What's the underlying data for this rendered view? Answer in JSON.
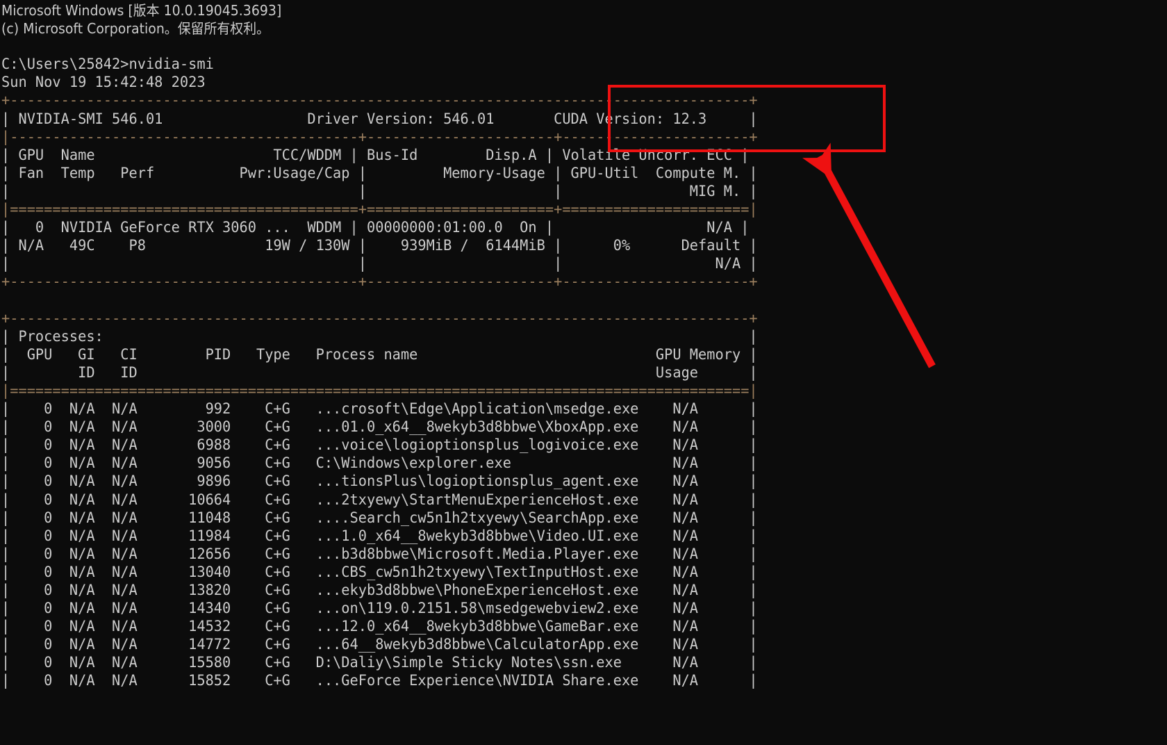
{
  "terminal": {
    "window_kind": "windows-command-prompt",
    "background_color": "#0c0c0c",
    "text_color": "#cccccc",
    "rule_color": "#9c7f5e",
    "banner": {
      "line1": "Microsoft Windows [版本 10.0.19045.3693]",
      "line2": "(c) Microsoft Corporation。保留所有权利。"
    },
    "prompt": {
      "path": "C:\\Users\\25842>",
      "command": "nvidia-smi",
      "full": "C:\\Users\\25842>nvidia-smi"
    },
    "timestamp": "Sun Nov 19 15:42:48 2023",
    "smi": {
      "border_top": "+---------------------------------------------------------------------------------------+",
      "version_line": "| NVIDIA-SMI 546.01                 Driver Version: 546.01       CUDA Version: 12.3     |",
      "nvidia_smi_version": "NVIDIA-SMI 546.01",
      "driver_version_label": "Driver Version: 546.01",
      "cuda_version_label": "CUDA Version: 12.3",
      "divider": "|-----------------------------------------+----------------------+----------------------+",
      "header_row1": "| GPU  Name                     TCC/WDDM | Bus-Id        Disp.A | Volatile Uncorr. ECC |",
      "header_row2": "| Fan  Temp   Perf          Pwr:Usage/Cap |         Memory-Usage | GPU-Util  Compute M. |",
      "header_row3": "|                                         |                      |               MIG M. |",
      "header_sep": "|=========================================+======================+======================|",
      "gpu_row1": "|   0  NVIDIA GeForce RTX 3060 ...  WDDM | 00000000:01:00.0  On |                  N/A |",
      "gpu_row2": "| N/A   49C    P8              19W / 130W |    939MiB /  6144MiB |      0%      Default |",
      "gpu_row3": "|                                         |                      |                  N/A |",
      "border_bottom": "+-----------------------------------------+----------------------+----------------------+",
      "gpu": {
        "index": "0",
        "name": "NVIDIA GeForce RTX 3060 ...",
        "tcc_wddm": "WDDM",
        "bus_id": "00000000:01:00.0",
        "disp_a": "On",
        "uncorr_ecc": "N/A",
        "fan": "N/A",
        "temp": "49C",
        "perf": "P8",
        "pwr_usage_cap": "19W / 130W",
        "memory_usage": "939MiB /  6144MiB",
        "gpu_util": "0%",
        "compute_m": "Default",
        "mig_m": "N/A"
      }
    },
    "processes": {
      "border_top": "+---------------------------------------------------------------------------------------+",
      "title": "| Processes:                                                                            |",
      "header_row1": "|  GPU   GI   CI        PID   Type   Process name                            GPU Memory |",
      "header_row2": "|        ID   ID                                                             Usage      |",
      "header_sep": "|=======================================================================================|",
      "columns": [
        "GPU",
        "GI ID",
        "CI ID",
        "PID",
        "Type",
        "Process name",
        "GPU Memory Usage"
      ],
      "rows": [
        {
          "gpu": "0",
          "gi": "N/A",
          "ci": "N/A",
          "pid": "992",
          "type": "C+G",
          "name": "...crosoft\\Edge\\Application\\msedge.exe",
          "mem": "N/A"
        },
        {
          "gpu": "0",
          "gi": "N/A",
          "ci": "N/A",
          "pid": "3000",
          "type": "C+G",
          "name": "...01.0_x64__8wekyb3d8bbwe\\XboxApp.exe",
          "mem": "N/A"
        },
        {
          "gpu": "0",
          "gi": "N/A",
          "ci": "N/A",
          "pid": "6988",
          "type": "C+G",
          "name": "...voice\\logioptionsplus_logivoice.exe",
          "mem": "N/A"
        },
        {
          "gpu": "0",
          "gi": "N/A",
          "ci": "N/A",
          "pid": "9056",
          "type": "C+G",
          "name": "C:\\Windows\\explorer.exe",
          "mem": "N/A"
        },
        {
          "gpu": "0",
          "gi": "N/A",
          "ci": "N/A",
          "pid": "9896",
          "type": "C+G",
          "name": "...tionsPlus\\logioptionsplus_agent.exe",
          "mem": "N/A"
        },
        {
          "gpu": "0",
          "gi": "N/A",
          "ci": "N/A",
          "pid": "10664",
          "type": "C+G",
          "name": "...2txyewy\\StartMenuExperienceHost.exe",
          "mem": "N/A"
        },
        {
          "gpu": "0",
          "gi": "N/A",
          "ci": "N/A",
          "pid": "11048",
          "type": "C+G",
          "name": "....Search_cw5n1h2txyewy\\SearchApp.exe",
          "mem": "N/A"
        },
        {
          "gpu": "0",
          "gi": "N/A",
          "ci": "N/A",
          "pid": "11984",
          "type": "C+G",
          "name": "...1.0_x64__8wekyb3d8bbwe\\Video.UI.exe",
          "mem": "N/A"
        },
        {
          "gpu": "0",
          "gi": "N/A",
          "ci": "N/A",
          "pid": "12656",
          "type": "C+G",
          "name": "...b3d8bbwe\\Microsoft.Media.Player.exe",
          "mem": "N/A"
        },
        {
          "gpu": "0",
          "gi": "N/A",
          "ci": "N/A",
          "pid": "13040",
          "type": "C+G",
          "name": "...CBS_cw5n1h2txyewy\\TextInputHost.exe",
          "mem": "N/A"
        },
        {
          "gpu": "0",
          "gi": "N/A",
          "ci": "N/A",
          "pid": "13820",
          "type": "C+G",
          "name": "...ekyb3d8bbwe\\PhoneExperienceHost.exe",
          "mem": "N/A"
        },
        {
          "gpu": "0",
          "gi": "N/A",
          "ci": "N/A",
          "pid": "14340",
          "type": "C+G",
          "name": "...on\\119.0.2151.58\\msedgewebview2.exe",
          "mem": "N/A"
        },
        {
          "gpu": "0",
          "gi": "N/A",
          "ci": "N/A",
          "pid": "14532",
          "type": "C+G",
          "name": "...12.0_x64__8wekyb3d8bbwe\\GameBar.exe",
          "mem": "N/A"
        },
        {
          "gpu": "0",
          "gi": "N/A",
          "ci": "N/A",
          "pid": "14772",
          "type": "C+G",
          "name": "...64__8wekyb3d8bbwe\\CalculatorApp.exe",
          "mem": "N/A"
        },
        {
          "gpu": "0",
          "gi": "N/A",
          "ci": "N/A",
          "pid": "15580",
          "type": "C+G",
          "name": "D:\\Daliy\\Simple Sticky Notes\\ssn.exe",
          "mem": "N/A"
        },
        {
          "gpu": "0",
          "gi": "N/A",
          "ci": "N/A",
          "pid": "15852",
          "type": "C+G",
          "name": "...GeForce Experience\\NVIDIA Share.exe",
          "mem": "N/A"
        }
      ]
    }
  },
  "annotation": {
    "color": "#ee1111",
    "highlight_target": "CUDA Version: 12.3",
    "shapes": [
      "rectangle",
      "arrow"
    ]
  }
}
